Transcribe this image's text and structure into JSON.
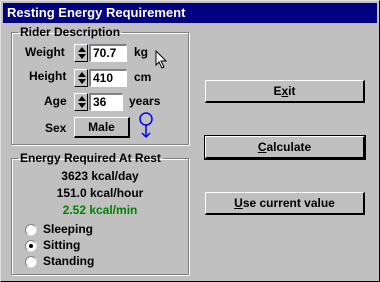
{
  "window": {
    "title": "Resting Energy Requirement"
  },
  "rider": {
    "legend": "Rider Description",
    "weight": {
      "label": "Weight",
      "value": "70.7",
      "unit": "kg"
    },
    "height": {
      "label": "Height",
      "value": "410",
      "unit": "cm"
    },
    "age": {
      "label": "Age",
      "value": "36",
      "unit": "years"
    },
    "sex": {
      "label": "Sex",
      "value": "Male",
      "icon": "male-symbol-icon"
    }
  },
  "energy": {
    "legend": "Energy Required At Rest",
    "per_day": "3623 kcal/day",
    "per_hour": "151.0 kcal/hour",
    "per_min": "2.52 kcal/min",
    "per_min_color": "#008000",
    "activity": [
      {
        "label": "Sleeping",
        "selected": false
      },
      {
        "label": "Sitting",
        "selected": true
      },
      {
        "label": "Standing",
        "selected": false
      }
    ]
  },
  "buttons": {
    "exit_pre": "E",
    "exit_u": "x",
    "exit_post": "it",
    "calc_pre": "",
    "calc_u": "C",
    "calc_post": "alculate",
    "use_pre": "",
    "use_u": "U",
    "use_post": "se current value"
  },
  "colors": {
    "titlebar": "#000080",
    "face": "#c0c0c0",
    "male_symbol": "#0000ff"
  }
}
